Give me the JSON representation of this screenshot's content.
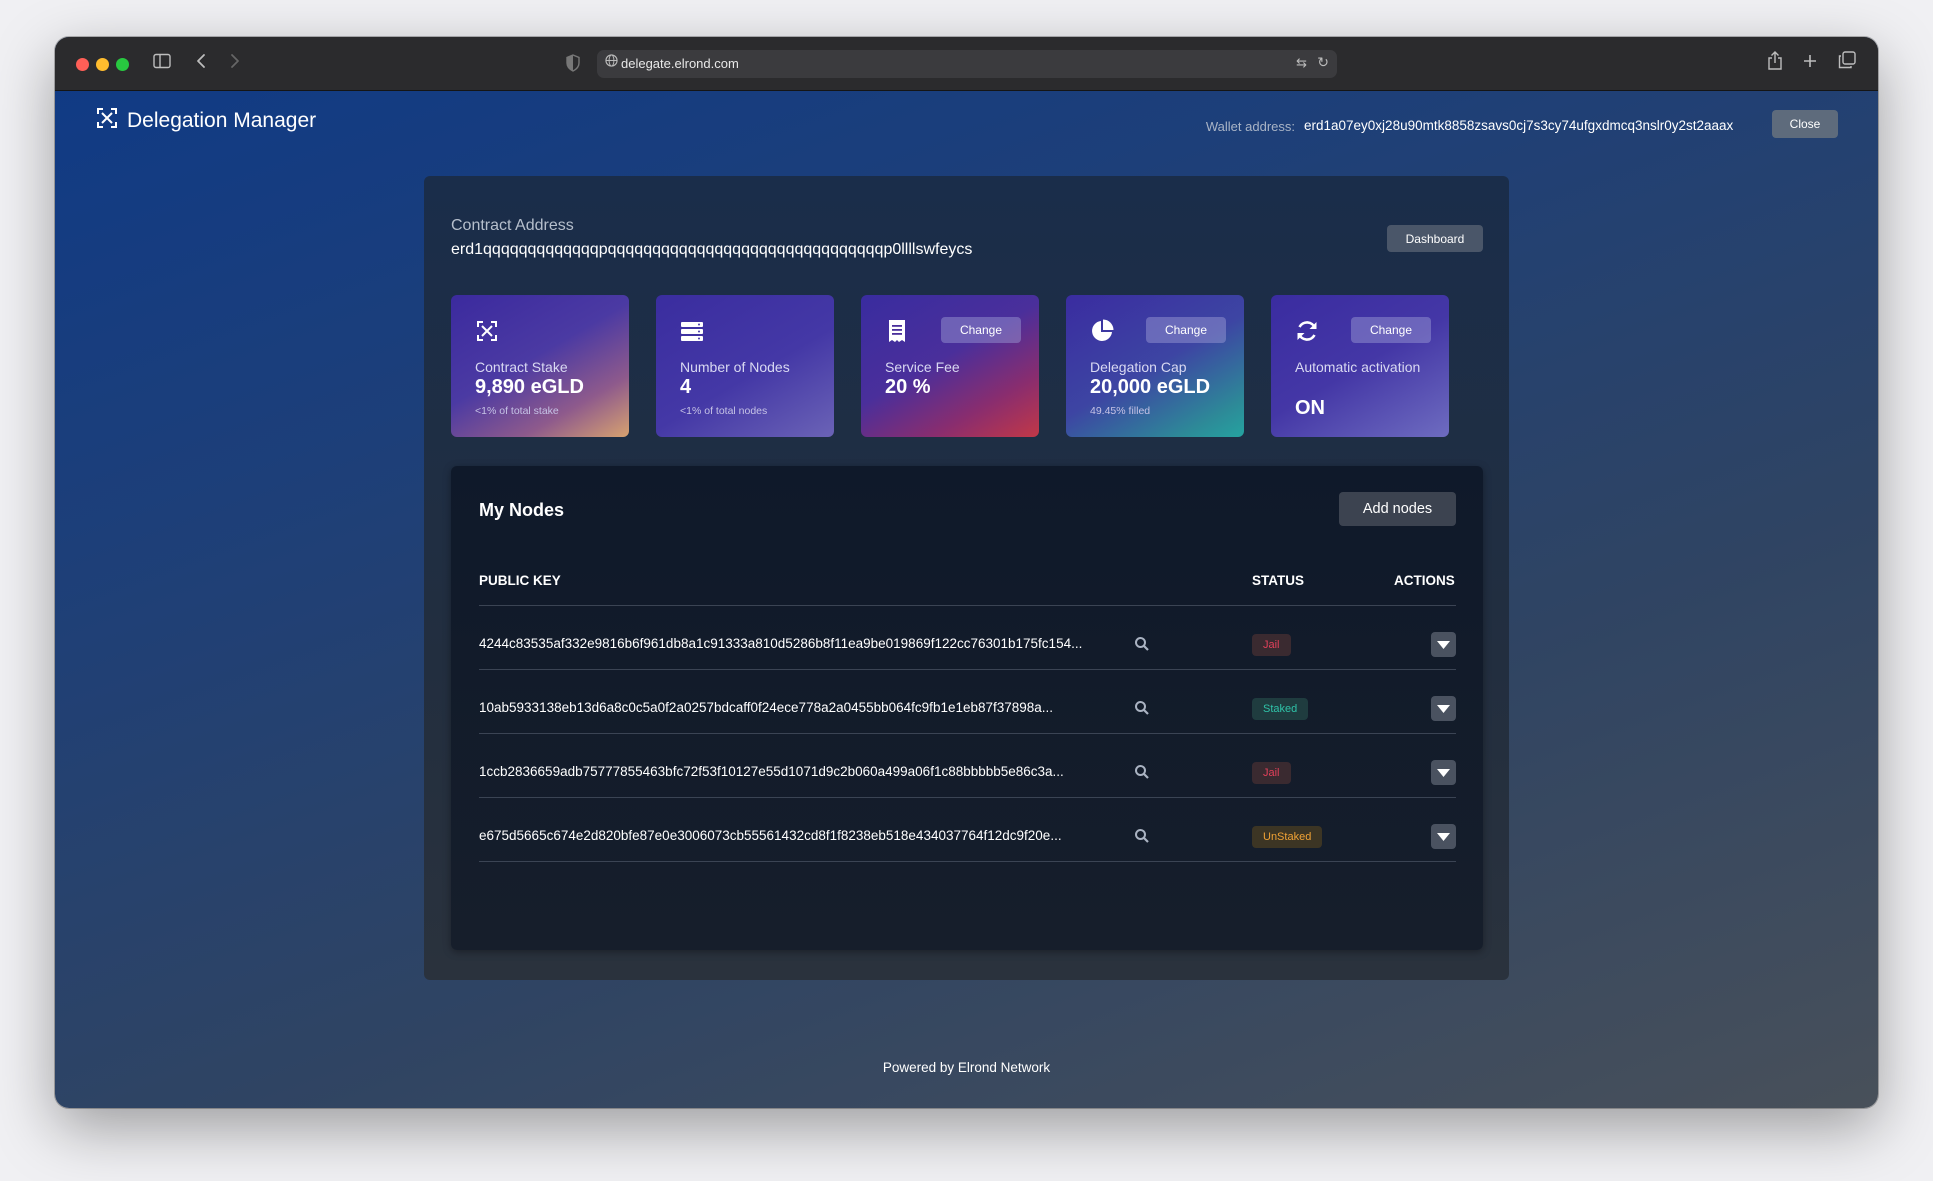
{
  "browser": {
    "url": "delegate.elrond.com"
  },
  "header": {
    "title": "Delegation Manager",
    "wallet_label": "Wallet address:",
    "wallet_address": "erd1a07ey0xj28u90mtk8858zsavs0cj7s3cy74ufgxdmcq3nslr0y2st2aaax",
    "close_label": "Close"
  },
  "contract": {
    "label": "Contract Address",
    "address": "erd1qqqqqqqqqqqqqpqqqqqqqqqqqqqqqqqqqqqqqqqqqqqqqp0llllswfeycs",
    "dashboard_label": "Dashboard"
  },
  "cards": [
    {
      "icon": "elrond-logo-icon",
      "label": "Contract Stake",
      "value": "9,890 eGLD",
      "sub": "<1% of total stake"
    },
    {
      "icon": "server-stack-icon",
      "label": "Number of Nodes",
      "value": "4",
      "sub": "<1% of total nodes"
    },
    {
      "icon": "receipt-icon",
      "label": "Service Fee",
      "value": "20 %",
      "change": "Change"
    },
    {
      "icon": "pie-chart-icon",
      "label": "Delegation Cap",
      "value": "20,000 eGLD",
      "sub": "49.45% filled",
      "change": "Change"
    },
    {
      "icon": "refresh-icon",
      "label": "Automatic activation",
      "value": "ON",
      "change": "Change"
    }
  ],
  "nodes": {
    "title": "My Nodes",
    "add_label": "Add nodes",
    "columns": {
      "key": "PUBLIC KEY",
      "status": "STATUS",
      "actions": "ACTIONS"
    },
    "rows": [
      {
        "key": "4244c83535af332e9816b6f961db8a1c91333a810d5286b8f11ea9be019869f122cc76301b175fc154...",
        "status": "Jail"
      },
      {
        "key": "10ab5933138eb13d6a8c0c5a0f2a0257bdcaff0f24ece778a2a0455bb064fc9fb1e1eb87f37898a...",
        "status": "Staked"
      },
      {
        "key": "1ccb2836659adb75777855463bfc72f53f10127e55d1071d9c2b060a499a06f1c88bbbbb5e86c3a...",
        "status": "Jail"
      },
      {
        "key": "e675d5665c674e2d820bfe87e0e3006073cb55561432cd8f1f8238eb518e434037764f12dc9f20e...",
        "status": "UnStaked"
      }
    ]
  },
  "footer": "Powered by Elrond Network",
  "colors": {
    "jail": "#e1405a",
    "staked": "#2fc2a8",
    "unstaked": "#f0a235"
  }
}
